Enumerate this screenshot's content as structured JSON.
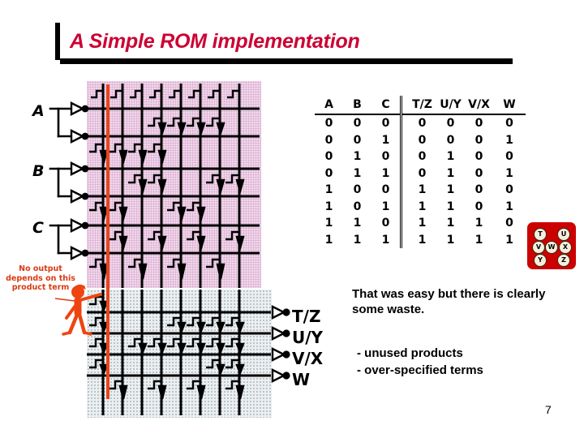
{
  "slide": {
    "title": "A Simple ROM implementation",
    "page_number": "7"
  },
  "inputs": [
    {
      "label": "A"
    },
    {
      "label": "B"
    },
    {
      "label": "C"
    }
  ],
  "outputs": [
    {
      "label": "T/Z"
    },
    {
      "label": "U/Y"
    },
    {
      "label": "V/X"
    },
    {
      "label": "W"
    }
  ],
  "annotation": {
    "note": "No output depends on this product term",
    "note_color": "#d93b12",
    "pointer_icon": "stick-figure-pointing-icon",
    "highlight_line_color": "#e8441c"
  },
  "truth_table": {
    "headers": [
      "A",
      "B",
      "C",
      "T/Z",
      "U/Y",
      "V/X",
      "W"
    ],
    "rows": [
      [
        "0",
        "0",
        "0",
        "0",
        "0",
        "0",
        "0"
      ],
      [
        "0",
        "0",
        "1",
        "0",
        "0",
        "0",
        "1"
      ],
      [
        "0",
        "1",
        "0",
        "0",
        "1",
        "0",
        "0"
      ],
      [
        "0",
        "1",
        "1",
        "0",
        "1",
        "0",
        "1"
      ],
      [
        "1",
        "0",
        "0",
        "1",
        "1",
        "0",
        "0"
      ],
      [
        "1",
        "0",
        "1",
        "1",
        "1",
        "0",
        "1"
      ],
      [
        "1",
        "1",
        "0",
        "1",
        "1",
        "1",
        "0"
      ],
      [
        "1",
        "1",
        "1",
        "1",
        "1",
        "1",
        "1"
      ]
    ]
  },
  "legend_box": {
    "background": "#cc0000",
    "cells": [
      "T",
      "U",
      "V",
      "W",
      "X",
      "Y",
      "Z"
    ]
  },
  "commentary": {
    "headline": "That was easy but there is clearly some waste.",
    "bullets": [
      "- unused products",
      "- over-specified terms"
    ]
  },
  "arrays": {
    "and_plane_color": "#f0d8ea",
    "or_plane_color": "#eeeeee"
  }
}
